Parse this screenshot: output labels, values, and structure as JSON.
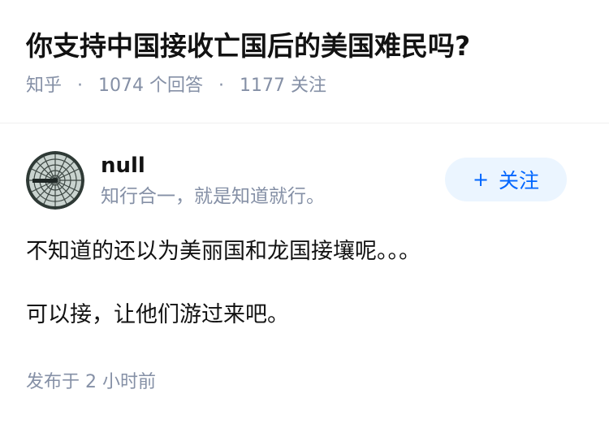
{
  "question": {
    "title": "你支持中国接收亡国后的美国难民吗?",
    "source": "知乎",
    "separator": "·",
    "answers_count": "1074 个回答",
    "followers_count": "1177 关注"
  },
  "author": {
    "name": "null",
    "bio": "知行合一，就是知道就行。",
    "follow_label": "关注",
    "follow_icon": "+"
  },
  "answer": {
    "paragraphs": [
      "不知道的还以为美丽国和龙国接壤呢。。。",
      "可以接，让他们游过来吧。"
    ],
    "published": "发布于  2 小时前"
  },
  "colors": {
    "title": "#121212",
    "meta": "#8590a6",
    "accent": "#0066ff",
    "follow_bg": "#ebf5ff"
  }
}
